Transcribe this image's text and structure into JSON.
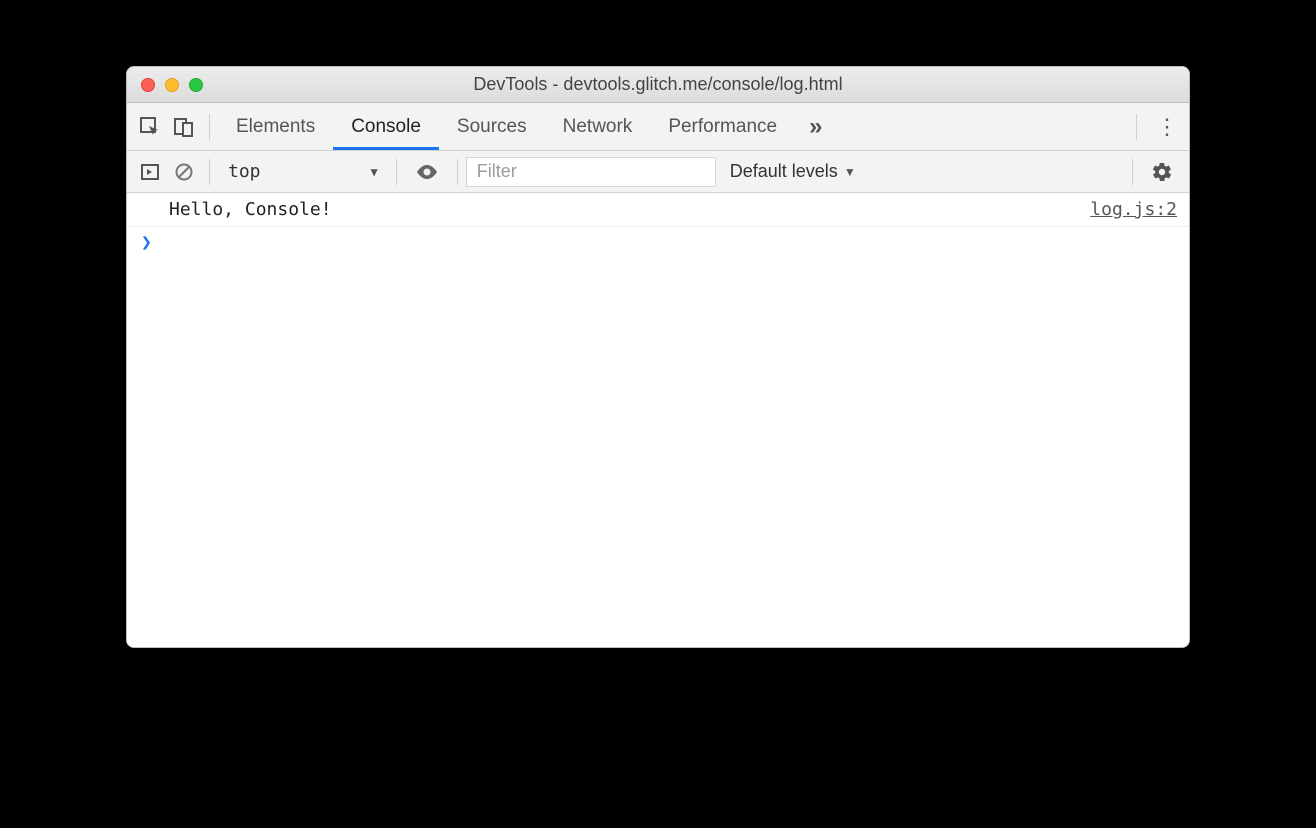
{
  "window": {
    "title": "DevTools - devtools.glitch.me/console/log.html"
  },
  "tabs": {
    "elements": "Elements",
    "console": "Console",
    "sources": "Sources",
    "network": "Network",
    "performance": "Performance"
  },
  "toolbar": {
    "context": "top",
    "filter_placeholder": "Filter",
    "levels": "Default levels"
  },
  "console": {
    "log_message": "Hello, Console!",
    "log_source": "log.js:2"
  }
}
